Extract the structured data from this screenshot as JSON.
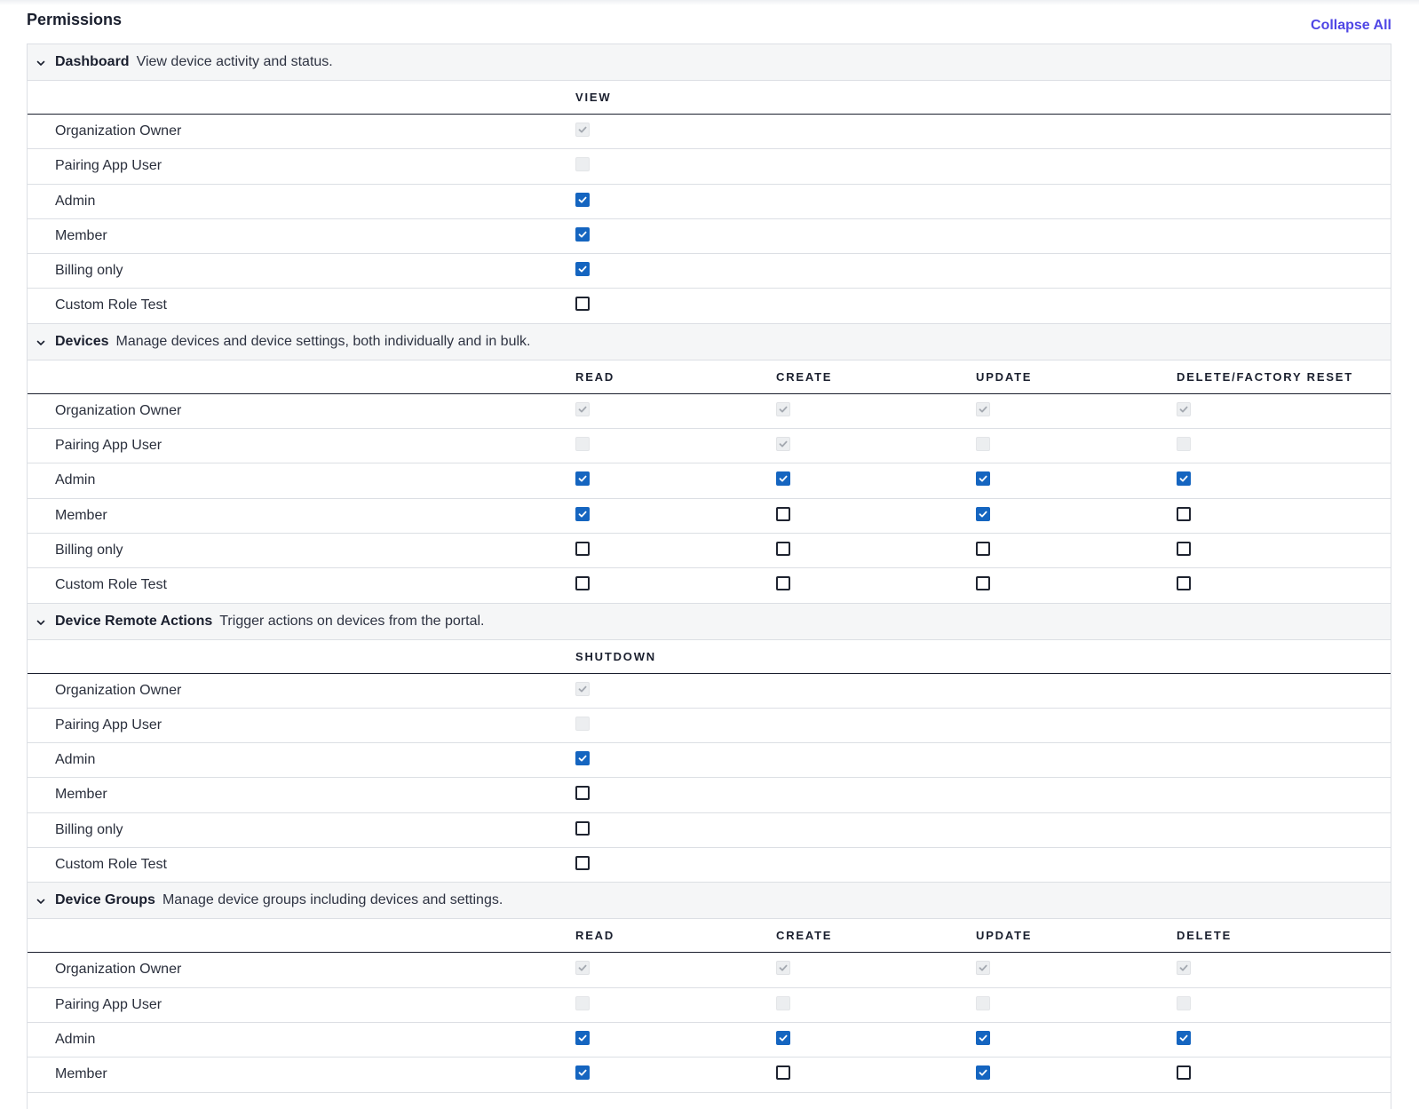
{
  "page": {
    "title": "Permissions",
    "collapse_label": "Collapse All"
  },
  "colors": {
    "accent": "#4f46e5",
    "checkbox_checked": "#1565c0",
    "disabled": "#eceef0"
  },
  "icons": {
    "section_toggle": "chevron-down-icon",
    "check": "check-icon"
  },
  "sections": [
    {
      "id": "dashboard",
      "title": "Dashboard",
      "description": "View device activity and status.",
      "columns": [
        "VIEW"
      ],
      "rows": [
        {
          "role": "Organization Owner",
          "states": [
            "disabled-checked"
          ]
        },
        {
          "role": "Pairing App User",
          "states": [
            "disabled"
          ]
        },
        {
          "role": "Admin",
          "states": [
            "checked"
          ]
        },
        {
          "role": "Member",
          "states": [
            "checked"
          ]
        },
        {
          "role": "Billing only",
          "states": [
            "checked"
          ]
        },
        {
          "role": "Custom Role Test",
          "states": [
            "unchecked"
          ]
        }
      ]
    },
    {
      "id": "devices",
      "title": "Devices",
      "description": "Manage devices and device settings, both individually and in bulk.",
      "columns": [
        "READ",
        "CREATE",
        "UPDATE",
        "DELETE/FACTORY RESET"
      ],
      "rows": [
        {
          "role": "Organization Owner",
          "states": [
            "disabled-checked",
            "disabled-checked",
            "disabled-checked",
            "disabled-checked"
          ]
        },
        {
          "role": "Pairing App User",
          "states": [
            "disabled",
            "disabled-checked",
            "disabled",
            "disabled"
          ]
        },
        {
          "role": "Admin",
          "states": [
            "checked",
            "checked",
            "checked",
            "checked"
          ]
        },
        {
          "role": "Member",
          "states": [
            "checked",
            "unchecked",
            "checked",
            "unchecked"
          ]
        },
        {
          "role": "Billing only",
          "states": [
            "unchecked",
            "unchecked",
            "unchecked",
            "unchecked"
          ]
        },
        {
          "role": "Custom Role Test",
          "states": [
            "unchecked",
            "unchecked",
            "unchecked",
            "unchecked"
          ]
        }
      ]
    },
    {
      "id": "device-remote-actions",
      "title": "Device Remote Actions",
      "description": "Trigger actions on devices from the portal.",
      "columns": [
        "SHUTDOWN"
      ],
      "rows": [
        {
          "role": "Organization Owner",
          "states": [
            "disabled-checked"
          ]
        },
        {
          "role": "Pairing App User",
          "states": [
            "disabled"
          ]
        },
        {
          "role": "Admin",
          "states": [
            "checked"
          ]
        },
        {
          "role": "Member",
          "states": [
            "unchecked"
          ]
        },
        {
          "role": "Billing only",
          "states": [
            "unchecked"
          ]
        },
        {
          "role": "Custom Role Test",
          "states": [
            "unchecked"
          ]
        }
      ]
    },
    {
      "id": "device-groups",
      "title": "Device Groups",
      "description": "Manage device groups including devices and settings.",
      "columns": [
        "READ",
        "CREATE",
        "UPDATE",
        "DELETE"
      ],
      "rows": [
        {
          "role": "Organization Owner",
          "states": [
            "disabled-checked",
            "disabled-checked",
            "disabled-checked",
            "disabled-checked"
          ]
        },
        {
          "role": "Pairing App User",
          "states": [
            "disabled",
            "disabled",
            "disabled",
            "disabled"
          ]
        },
        {
          "role": "Admin",
          "states": [
            "checked",
            "checked",
            "checked",
            "checked"
          ]
        },
        {
          "role": "Member",
          "states": [
            "checked",
            "unchecked",
            "checked",
            "unchecked"
          ]
        }
      ]
    }
  ]
}
